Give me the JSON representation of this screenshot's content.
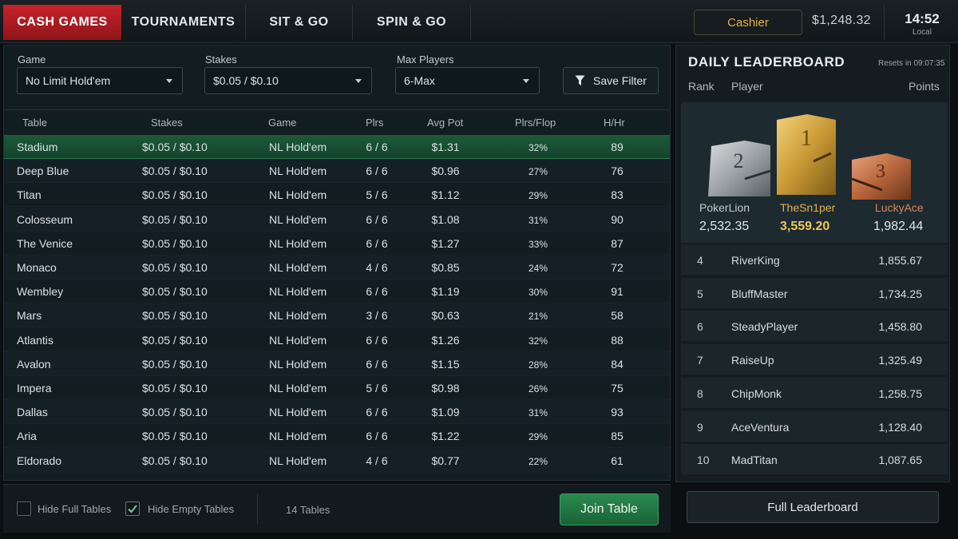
{
  "tabs": [
    {
      "label": "CASH GAMES",
      "active": true
    },
    {
      "label": "TOURNAMENTS",
      "active": false
    },
    {
      "label": "SIT & GO",
      "active": false
    },
    {
      "label": "SPIN & GO",
      "active": false
    }
  ],
  "header": {
    "cashier_label": "Cashier",
    "balance": "$1,248.32",
    "time": "14:52",
    "time_sub": "Local"
  },
  "filters": {
    "game": {
      "label": "Game",
      "value": "No Limit Hold'em"
    },
    "stakes": {
      "label": "Stakes",
      "value": "$0.05 / $0.10"
    },
    "max_players": {
      "label": "Max Players",
      "value": "6-Max"
    },
    "save_label": "Save Filter"
  },
  "columns": [
    "Table",
    "Stakes",
    "Game",
    "Plrs",
    "Avg Pot",
    "Plrs/Flop",
    "H/Hr"
  ],
  "tables": [
    {
      "name": "Stadium",
      "stakes": "$0.05 / $0.10",
      "game": "NL Hold'em",
      "plrs": "6 / 6",
      "avg_pot": "$1.31",
      "plrs_flop": "32%",
      "hhr": "89"
    },
    {
      "name": "Deep Blue",
      "stakes": "$0.05 / $0.10",
      "game": "NL Hold'em",
      "plrs": "6 / 6",
      "avg_pot": "$0.96",
      "plrs_flop": "27%",
      "hhr": "76"
    },
    {
      "name": "Titan",
      "stakes": "$0.05 / $0.10",
      "game": "NL Hold'em",
      "plrs": "5 / 6",
      "avg_pot": "$1.12",
      "plrs_flop": "29%",
      "hhr": "83"
    },
    {
      "name": "Colosseum",
      "stakes": "$0.05 / $0.10",
      "game": "NL Hold'em",
      "plrs": "6 / 6",
      "avg_pot": "$1.08",
      "plrs_flop": "31%",
      "hhr": "90"
    },
    {
      "name": "The Venice",
      "stakes": "$0.05 / $0.10",
      "game": "NL Hold'em",
      "plrs": "6 / 6",
      "avg_pot": "$1.27",
      "plrs_flop": "33%",
      "hhr": "87"
    },
    {
      "name": "Monaco",
      "stakes": "$0.05 / $0.10",
      "game": "NL Hold'em",
      "plrs": "4 / 6",
      "avg_pot": "$0.85",
      "plrs_flop": "24%",
      "hhr": "72"
    },
    {
      "name": "Wembley",
      "stakes": "$0.05 / $0.10",
      "game": "NL Hold'em",
      "plrs": "6 / 6",
      "avg_pot": "$1.19",
      "plrs_flop": "30%",
      "hhr": "91"
    },
    {
      "name": "Mars",
      "stakes": "$0.05 / $0.10",
      "game": "NL Hold'em",
      "plrs": "3 / 6",
      "avg_pot": "$0.63",
      "plrs_flop": "21%",
      "hhr": "58"
    },
    {
      "name": "Atlantis",
      "stakes": "$0.05 / $0.10",
      "game": "NL Hold'em",
      "plrs": "6 / 6",
      "avg_pot": "$1.26",
      "plrs_flop": "32%",
      "hhr": "88"
    },
    {
      "name": "Avalon",
      "stakes": "$0.05 / $0.10",
      "game": "NL Hold'em",
      "plrs": "6 / 6",
      "avg_pot": "$1.15",
      "plrs_flop": "28%",
      "hhr": "84"
    },
    {
      "name": "Impera",
      "stakes": "$0.05 / $0.10",
      "game": "NL Hold'em",
      "plrs": "5 / 6",
      "avg_pot": "$0.98",
      "plrs_flop": "26%",
      "hhr": "75"
    },
    {
      "name": "Dallas",
      "stakes": "$0.05 / $0.10",
      "game": "NL Hold'em",
      "plrs": "6 / 6",
      "avg_pot": "$1.09",
      "plrs_flop": "31%",
      "hhr": "93"
    },
    {
      "name": "Aria",
      "stakes": "$0.05 / $0.10",
      "game": "NL Hold'em",
      "plrs": "6 / 6",
      "avg_pot": "$1.22",
      "plrs_flop": "29%",
      "hhr": "85"
    },
    {
      "name": "Eldorado",
      "stakes": "$0.05 / $0.10",
      "game": "NL Hold'em",
      "plrs": "4 / 6",
      "avg_pot": "$0.77",
      "plrs_flop": "22%",
      "hhr": "61"
    }
  ],
  "bottom": {
    "hide_full_label": "Hide Full Tables",
    "hide_full_checked": false,
    "hide_empty_label": "Hide Empty Tables",
    "hide_empty_checked": true,
    "table_count": "14 Tables",
    "join_label": "Join Table"
  },
  "leaderboard": {
    "title": "DAILY LEADERBOARD",
    "reset_text": "Resets in 09:07:35",
    "col_rank": "Rank",
    "col_player": "Player",
    "col_points": "Points",
    "podium": {
      "first": {
        "rank": "1",
        "name": "TheSn1per",
        "points": "3,559.20"
      },
      "second": {
        "rank": "2",
        "name": "PokerLion",
        "points": "2,532.35"
      },
      "third": {
        "rank": "3",
        "name": "LuckyAce",
        "points": "1,982.44"
      }
    },
    "rows": [
      {
        "rank": "4",
        "name": "RiverKing",
        "points": "1,855.67"
      },
      {
        "rank": "5",
        "name": "BluffMaster",
        "points": "1,734.25"
      },
      {
        "rank": "6",
        "name": "SteadyPlayer",
        "points": "1,458.80"
      },
      {
        "rank": "7",
        "name": "RaiseUp",
        "points": "1,325.49"
      },
      {
        "rank": "8",
        "name": "ChipMonk",
        "points": "1,258.75"
      },
      {
        "rank": "9",
        "name": "AceVentura",
        "points": "1,128.40"
      },
      {
        "rank": "10",
        "name": "MadTitan",
        "points": "1,087.65"
      }
    ],
    "full_label": "Full Leaderboard"
  },
  "colors": {
    "accent_red": "#c8232b",
    "gold": "#e4b24a",
    "join_green": "#2a8a4f",
    "bronze": "#d98a5a"
  }
}
